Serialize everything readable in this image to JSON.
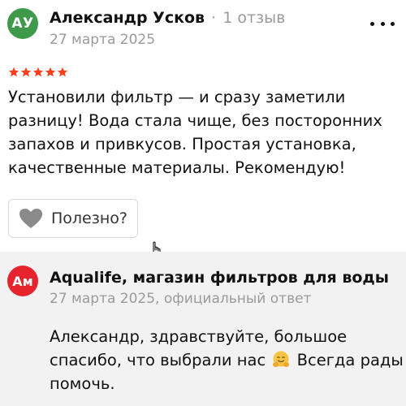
{
  "review": {
    "avatar_initials": "АУ",
    "avatar_color": "#3e9a4a",
    "author_name": "Александр Усков",
    "separator": "·",
    "review_count": "1 отзыв",
    "date": "27 марта 2025",
    "more_icon": "more-dots-icon",
    "rating": 5,
    "rating_max": 5,
    "star_color": "#fc3f1d",
    "text": "Установили фильтр — и сразу заметили разницу! Вода стала чище, без посторонних запахов и привкусов. Простая установка, качественные материалы. Рекомендую!",
    "helpful_icon": "heart-icon",
    "helpful_label": "Полезно?"
  },
  "reply": {
    "avatar_initials": "Ам",
    "avatar_color": "#e5242d",
    "author_name": "Aqualife, магазин фильтров для воды",
    "meta": "27 марта 2025, официальный ответ",
    "text_before_emoji": "Александр, здравствуйте, большое спасибо, что выбрали нас",
    "emoji": "hugging-face-emoji",
    "text_after_emoji": "Всегда рады помочь."
  }
}
